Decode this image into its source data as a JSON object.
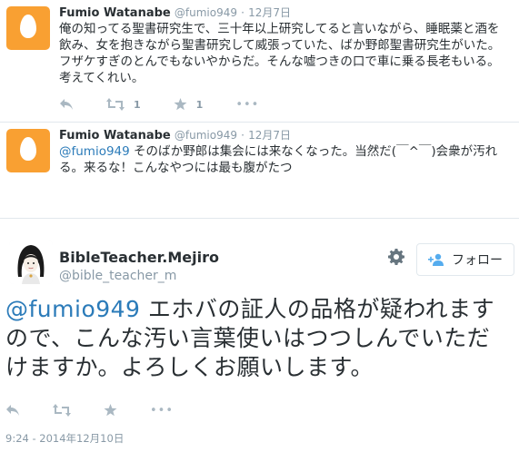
{
  "tweets": [
    {
      "name": "Fumio Watanabe",
      "handle": "@fumio949",
      "dot": "·",
      "date": "12月7日",
      "text": "俺の知ってる聖書研究生で、三十年以上研究してると言いながら、睡眠薬と酒を飲み、女を抱きながら聖書研究して威張っていた、ばか野郎聖書研究生がいた。フザケすぎのとんでもないやからだ。そんな嘘つきの口で車に乗る長老もいる。考えてくれい。",
      "retweet_count": "1",
      "favorite_count": "1"
    },
    {
      "name": "Fumio Watanabe",
      "handle": "@fumio949",
      "dot": "·",
      "date": "12月7日",
      "mention": "@fumio949",
      "text": " そのばか野郎は集会には来なくなった。当然だ(￣^￣)会衆が汚れる。来るな！こんなやつには最も腹がたつ"
    }
  ],
  "main": {
    "name": "BibleTeacher.Mejiro",
    "handle": "@bible_teacher_m",
    "follow_label": "フォロー",
    "mention": "@fumio949",
    "text": " エホバの証人の品格が疑われますので、こんな汚い言葉使いはつつしんでいただけますか。よろしくお願いします。",
    "timestamp": "9:24 - 2014年12月10日"
  },
  "icons": {
    "reply": "reply-icon",
    "retweet": "retweet-icon",
    "favorite": "star-icon",
    "more": "more-icon",
    "gear": "gear-icon",
    "follow": "follow-user-icon"
  },
  "colors": {
    "egg_bg": "#f9a032",
    "link": "#2b7bb9",
    "muted": "#8899a6",
    "icon": "#aab8c2"
  }
}
